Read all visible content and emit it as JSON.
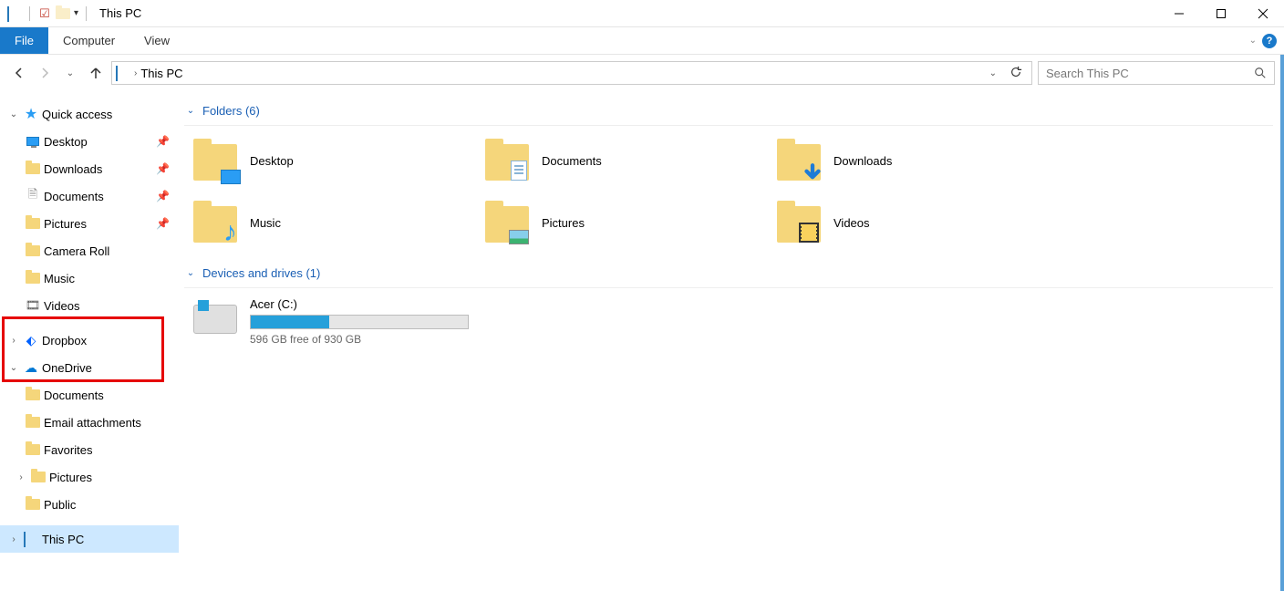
{
  "title": "This PC",
  "ribbon": {
    "file": "File",
    "computer": "Computer",
    "view": "View"
  },
  "address": {
    "location": "This PC"
  },
  "search": {
    "placeholder": "Search This PC"
  },
  "sidebar": {
    "quick_access": "Quick access",
    "qa_items": [
      {
        "label": "Desktop",
        "pinned": true
      },
      {
        "label": "Downloads",
        "pinned": true
      },
      {
        "label": "Documents",
        "pinned": true
      },
      {
        "label": "Pictures",
        "pinned": true
      },
      {
        "label": "Camera Roll",
        "pinned": false
      },
      {
        "label": "Music",
        "pinned": false
      },
      {
        "label": "Videos",
        "pinned": false
      }
    ],
    "dropbox": "Dropbox",
    "onedrive": "OneDrive",
    "od_items": [
      "Documents",
      "Email attachments",
      "Favorites",
      "Pictures",
      "Public"
    ],
    "this_pc": "This PC"
  },
  "sections": {
    "folders_header": "Folders (6)",
    "folders": [
      "Desktop",
      "Documents",
      "Downloads",
      "Music",
      "Pictures",
      "Videos"
    ],
    "drives_header": "Devices and drives (1)",
    "drive": {
      "name": "Acer (C:)",
      "free_text": "596 GB free of 930 GB",
      "used_fraction": 0.36
    }
  }
}
